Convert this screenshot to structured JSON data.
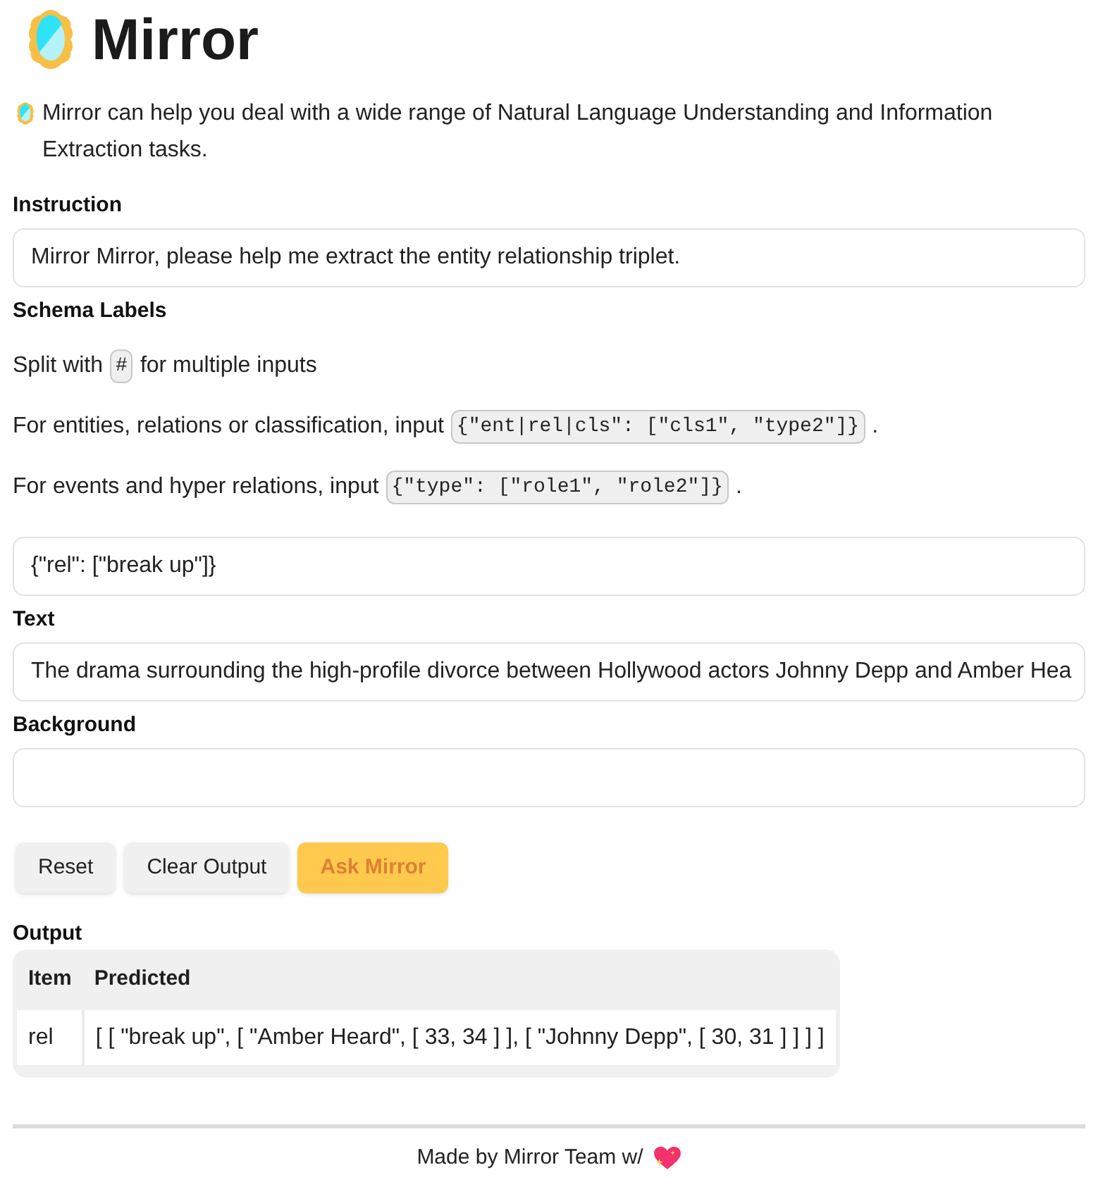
{
  "header": {
    "title": "Mirror"
  },
  "intro": {
    "text": "Mirror can help you deal with a wide range of Natural Language Understanding and Information Extraction tasks."
  },
  "instruction": {
    "label": "Instruction",
    "value": "Mirror Mirror, please help me extract the entity relationship triplet."
  },
  "schema_labels": {
    "label": "Schema Labels",
    "hints": [
      {
        "before": "Split with",
        "code": "#",
        "after": "for multiple inputs"
      },
      {
        "before": "For entities, relations or classification, input",
        "code": "{\"ent|rel|cls\": [\"cls1\", \"type2\"]}",
        "after": "."
      },
      {
        "before": "For events and hyper relations, input",
        "code": "{\"type\": [\"role1\", \"role2\"]}",
        "after": "."
      }
    ],
    "value": "{\"rel\": [\"break up\"]}"
  },
  "text": {
    "label": "Text",
    "value": "The drama surrounding the high-profile divorce between Hollywood actors Johnny Depp and Amber Hea"
  },
  "background": {
    "label": "Background"
  },
  "buttons": [
    {
      "label": "Reset",
      "kind": "secondary"
    },
    {
      "label": "Clear Output",
      "kind": "secondary"
    },
    {
      "label": "Ask Mirror",
      "kind": "primary"
    }
  ],
  "output": {
    "label": "Output",
    "columns": [
      "Item",
      "Predicted"
    ],
    "rows": [
      [
        "rel",
        "[ [ \"break up\", [ \"Amber Heard\", [ 33, 34 ] ], [ \"Johnny Depp\", [ 30, 31 ] ] ] ]"
      ]
    ]
  },
  "footer": {
    "text": "Made by Mirror Team w/"
  }
}
